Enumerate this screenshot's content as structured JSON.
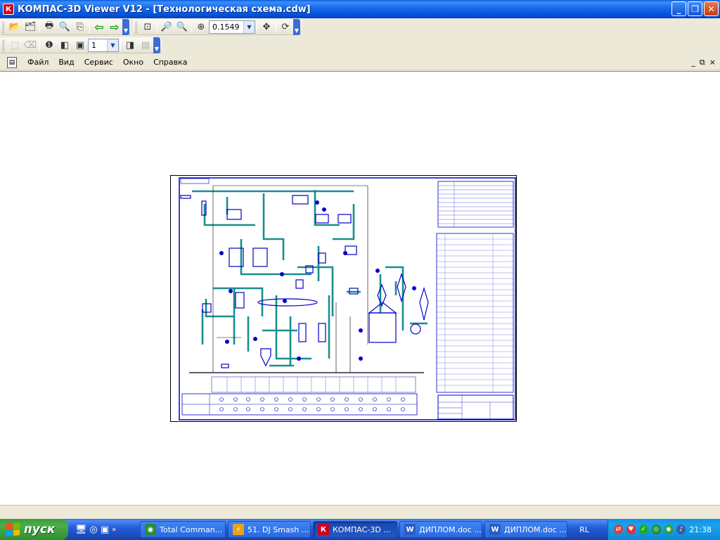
{
  "window": {
    "title": "КОМПАС-3D Viewer V12 - [Технологическая схема.cdw]",
    "app_icon_letter": "К"
  },
  "toolbar1": {
    "zoom_value": "0.1549"
  },
  "toolbar2": {
    "page_value": "1"
  },
  "menu": {
    "items": [
      "Файл",
      "Вид",
      "Сервис",
      "Окно",
      "Справка"
    ]
  },
  "mdi": {
    "minimize": "_",
    "restore": "⧉",
    "close": "×"
  },
  "taskbar": {
    "start_label": "пуск",
    "tasks": [
      {
        "label": "Total Comman...",
        "icon": "total-commander-icon",
        "color": "#2a8a3c"
      },
      {
        "label": "51. DJ Smash ...",
        "icon": "winamp-icon",
        "color": "#e9a21b"
      },
      {
        "label": "КОМПАС-3D ...",
        "icon": "kompas-icon",
        "color": "#d0021b"
      },
      {
        "label": "ДИПЛОМ.doc ...",
        "icon": "word-icon",
        "color": "#2d5bc4"
      },
      {
        "label": "ДИПЛОМ.doc ...",
        "icon": "word-icon",
        "color": "#2d5bc4"
      }
    ],
    "language": "RL",
    "clock": "21:38"
  },
  "colors": {
    "pipe": "#1a8e8e",
    "equipment": "#0000c8",
    "frame": "#000000"
  }
}
